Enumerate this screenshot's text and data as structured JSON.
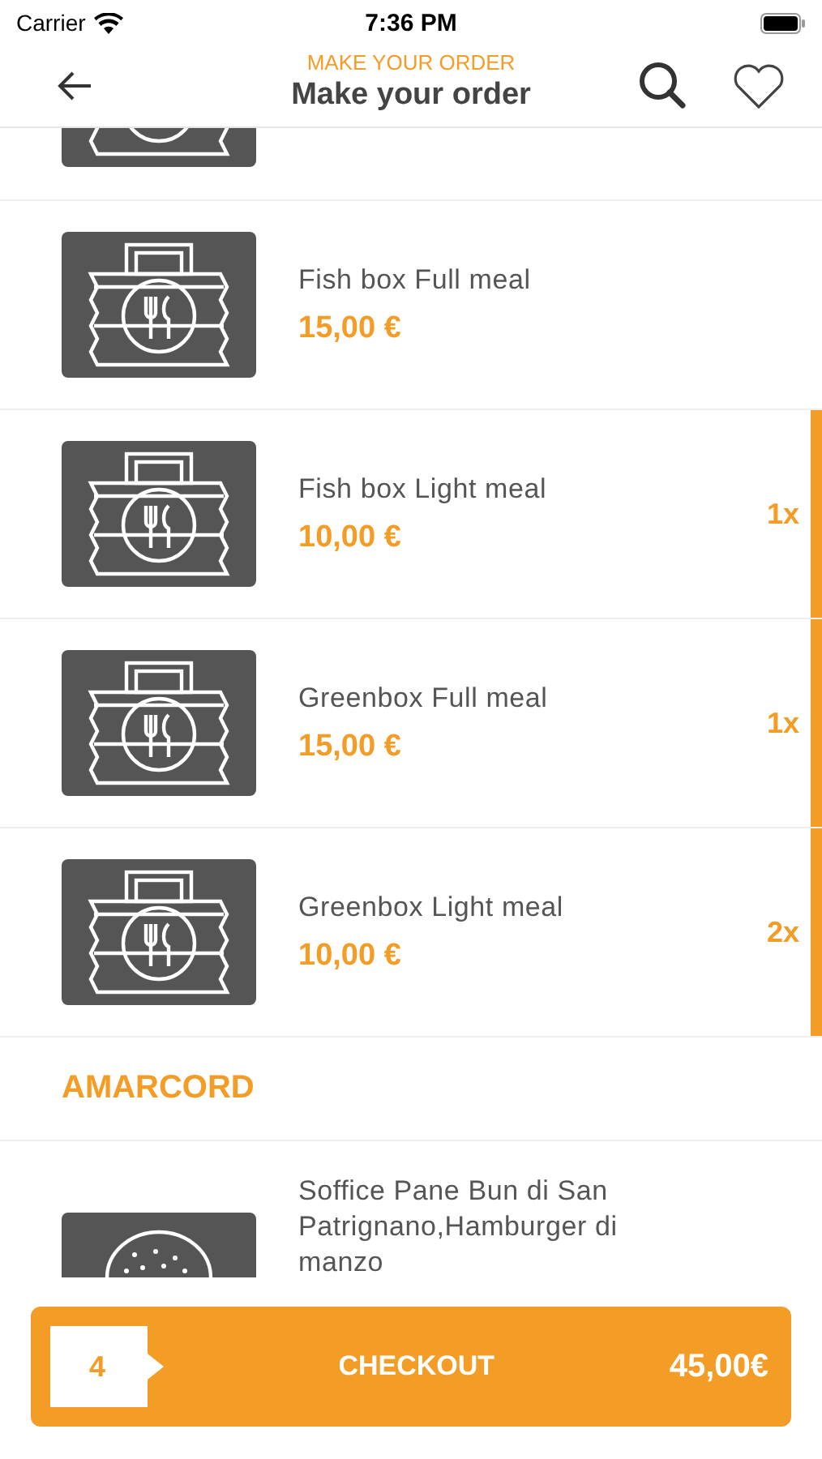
{
  "status_bar": {
    "carrier": "Carrier",
    "time": "7:36 PM"
  },
  "nav": {
    "subtitle": "MAKE YOUR ORDER",
    "title": "Make your order"
  },
  "list": [
    {
      "kind": "box",
      "name": "Fish box Full meal",
      "price": "15,00 €"
    },
    {
      "kind": "box",
      "name": "Fish box Light meal",
      "price": "10,00 €",
      "quantity": "1x"
    },
    {
      "kind": "box",
      "name": "Greenbox Full meal",
      "price": "15,00 €",
      "quantity": "1x"
    },
    {
      "kind": "box",
      "name": "Greenbox Light meal",
      "price": "10,00 €",
      "quantity": "2x"
    },
    {
      "kind": "section",
      "title": "AMARCORD"
    },
    {
      "kind": "burger",
      "name": "Soffice Pane Bun di San Patrignano,Hamburger di manzo"
    }
  ],
  "checkout": {
    "count": "4",
    "label": "CHECKOUT",
    "total": "45,00€"
  }
}
